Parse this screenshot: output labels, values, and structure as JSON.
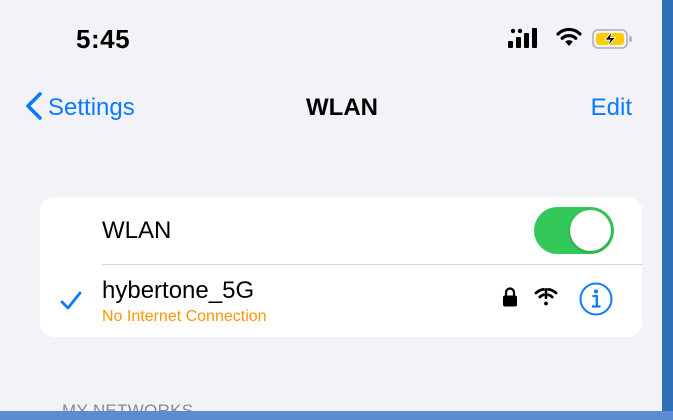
{
  "status_bar": {
    "time": "5:45",
    "icons": [
      "cellular-signal-icon",
      "wifi-icon",
      "battery-charging-icon"
    ]
  },
  "nav": {
    "back_label": "Settings",
    "title": "WLAN",
    "edit_label": "Edit"
  },
  "wlan_toggle": {
    "label": "WLAN",
    "on": true
  },
  "connected_network": {
    "name": "hybertone_5G",
    "status": "No Internet Connection",
    "secured": true
  },
  "sections": {
    "my_networks": "MY NETWORKS"
  },
  "colors": {
    "accent": "#0a7aff",
    "toggle_on": "#34c759",
    "warning": "#ff9500",
    "background": "#f2f2f7",
    "battery_charging": "#ffcc00"
  }
}
